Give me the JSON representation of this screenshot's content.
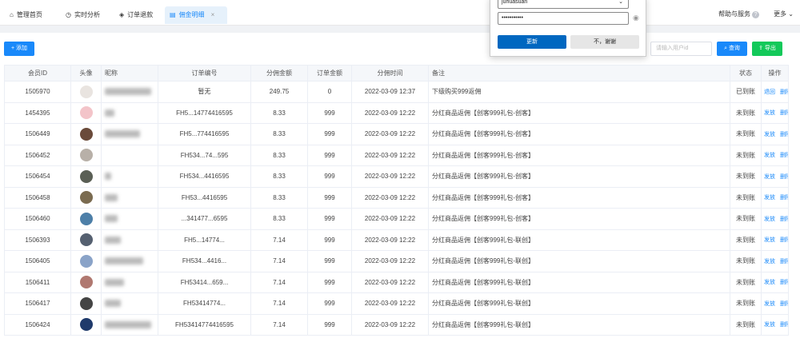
{
  "tabs": [
    {
      "label": "管理首页",
      "icon": "home-icon"
    },
    {
      "label": "实时分析",
      "icon": "clock-icon"
    },
    {
      "label": "订单退款",
      "icon": "tag-icon"
    },
    {
      "label": "佣金明细",
      "icon": "document-icon",
      "close": "×"
    }
  ],
  "header": {
    "help": "帮助与服务",
    "help_q": "?",
    "more": "更多"
  },
  "toolbar": {
    "add": "+ 添加",
    "search_placeholder": "请输入用户id",
    "search": "查询",
    "export": "导出"
  },
  "popup": {
    "username": "juhuasuan",
    "password": "•••••••••••",
    "update": "更新",
    "decline": "不，谢谢"
  },
  "table": {
    "headers": [
      "会员ID",
      "头像",
      "昵称",
      "订单编号",
      "分佣金额",
      "订单金额",
      "分佣时间",
      "备注",
      "状态",
      "操作"
    ],
    "rows": [
      {
        "id": "1505970",
        "order": "暂无",
        "commission": "249.75",
        "amount": "0",
        "time": "2022-03-09 12:37",
        "note": "下级购买999返佣",
        "status": "已到账",
        "op1": "退回",
        "op2": "删除",
        "av": "#e9e4e0"
      },
      {
        "id": "1454395",
        "order": "FH5...14774416595",
        "commission": "8.33",
        "amount": "999",
        "time": "2022-03-09 12:22",
        "note": "分红商品返佣【创客999礼包-创客】",
        "status": "未到账",
        "op1": "发放",
        "op2": "删除",
        "av": "#f3c4c9"
      },
      {
        "id": "1506449",
        "order": "FH5...774416595",
        "commission": "8.33",
        "amount": "999",
        "time": "2022-03-09 12:22",
        "note": "分红商品返佣【创客999礼包-创客】",
        "status": "未到账",
        "op1": "发放",
        "op2": "删除",
        "av": "#6a4a3a"
      },
      {
        "id": "1506452",
        "order": "FH534...74...595",
        "commission": "8.33",
        "amount": "999",
        "time": "2022-03-09 12:22",
        "note": "分红商品返佣【创客999礼包-创客】",
        "status": "未到账",
        "op1": "发放",
        "op2": "删除",
        "av": "#b8b0a8"
      },
      {
        "id": "1506454",
        "order": "FH534...4416595",
        "commission": "8.33",
        "amount": "999",
        "time": "2022-03-09 12:22",
        "note": "分红商品返佣【创客999礼包-创客】",
        "status": "未到账",
        "op1": "发放",
        "op2": "删除",
        "av": "#5a5f55"
      },
      {
        "id": "1506458",
        "order": "FH53...4416595",
        "commission": "8.33",
        "amount": "999",
        "time": "2022-03-09 12:22",
        "note": "分红商品返佣【创客999礼包-创客】",
        "status": "未到账",
        "op1": "发放",
        "op2": "删除",
        "av": "#7a6b50"
      },
      {
        "id": "1506460",
        "order": "...341477...6595",
        "commission": "8.33",
        "amount": "999",
        "time": "2022-03-09 12:22",
        "note": "分红商品返佣【创客999礼包-创客】",
        "status": "未到账",
        "op1": "发放",
        "op2": "删除",
        "av": "#4d7fa8"
      },
      {
        "id": "1506393",
        "order": "FH5...14774...",
        "commission": "7.14",
        "amount": "999",
        "time": "2022-03-09 12:22",
        "note": "分红商品返佣【创客999礼包-联创】",
        "status": "未到账",
        "op1": "发放",
        "op2": "删除",
        "av": "#556070"
      },
      {
        "id": "1506405",
        "order": "FH534...4416...",
        "commission": "7.14",
        "amount": "999",
        "time": "2022-03-09 12:22",
        "note": "分红商品返佣【创客999礼包-联创】",
        "status": "未到账",
        "op1": "发放",
        "op2": "删除",
        "av": "#8aa3c8"
      },
      {
        "id": "1506411",
        "order": "FH53414...659...",
        "commission": "7.14",
        "amount": "999",
        "time": "2022-03-09 12:22",
        "note": "分红商品返佣【创客999礼包-联创】",
        "status": "未到账",
        "op1": "发放",
        "op2": "删除",
        "av": "#b07870"
      },
      {
        "id": "1506417",
        "order": "FH53414774...",
        "commission": "7.14",
        "amount": "999",
        "time": "2022-03-09 12:22",
        "note": "分红商品返佣【创客999礼包-联创】",
        "status": "未到账",
        "op1": "发放",
        "op2": "删除",
        "av": "#444"
      },
      {
        "id": "1506424",
        "order": "FH53414774416595",
        "commission": "7.14",
        "amount": "999",
        "time": "2022-03-09 12:22",
        "note": "分红商品返佣【创客999礼包-联创】",
        "status": "未到账",
        "op1": "发放",
        "op2": "删除",
        "av": "#1f3a6b"
      }
    ]
  },
  "colors": {
    "accent": "#1989fa",
    "export": "#13c95a"
  }
}
